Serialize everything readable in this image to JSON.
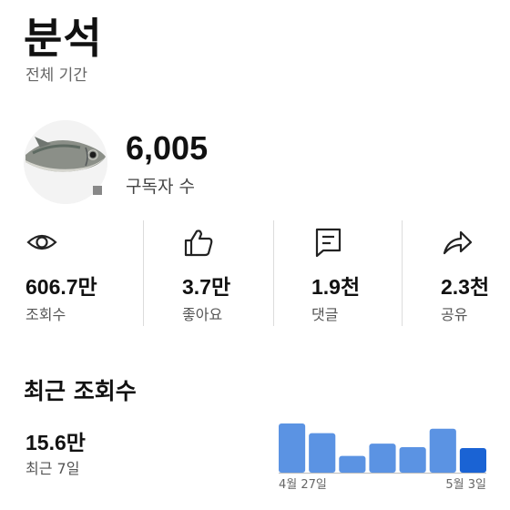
{
  "header": {
    "title": "분석",
    "subtitle": "전체 기간"
  },
  "channel": {
    "avatar_icon": "fish-image",
    "subscriber_count": "6,005",
    "subscriber_label": "구독자 수"
  },
  "stats": [
    {
      "icon": "eye-icon",
      "value": "606.7만",
      "label": "조회수"
    },
    {
      "icon": "thumbs-up-icon",
      "value": "3.7만",
      "label": "좋아요"
    },
    {
      "icon": "comment-icon",
      "value": "1.9천",
      "label": "댓글"
    },
    {
      "icon": "share-icon",
      "value": "2.3천",
      "label": "공유"
    }
  ],
  "recent_views": {
    "title": "최근 조회수",
    "value": "15.6만",
    "period": "최근 7일"
  },
  "chart_data": {
    "type": "bar",
    "x_labels": [
      "4월 27일",
      "5월 3일"
    ],
    "values": [
      56,
      45,
      19,
      33,
      29,
      50,
      28
    ],
    "highlight_index": 6,
    "colors": {
      "bar": "#5b93e3",
      "highlight": "#1a63d4",
      "axis": "#bdbdbd"
    }
  }
}
